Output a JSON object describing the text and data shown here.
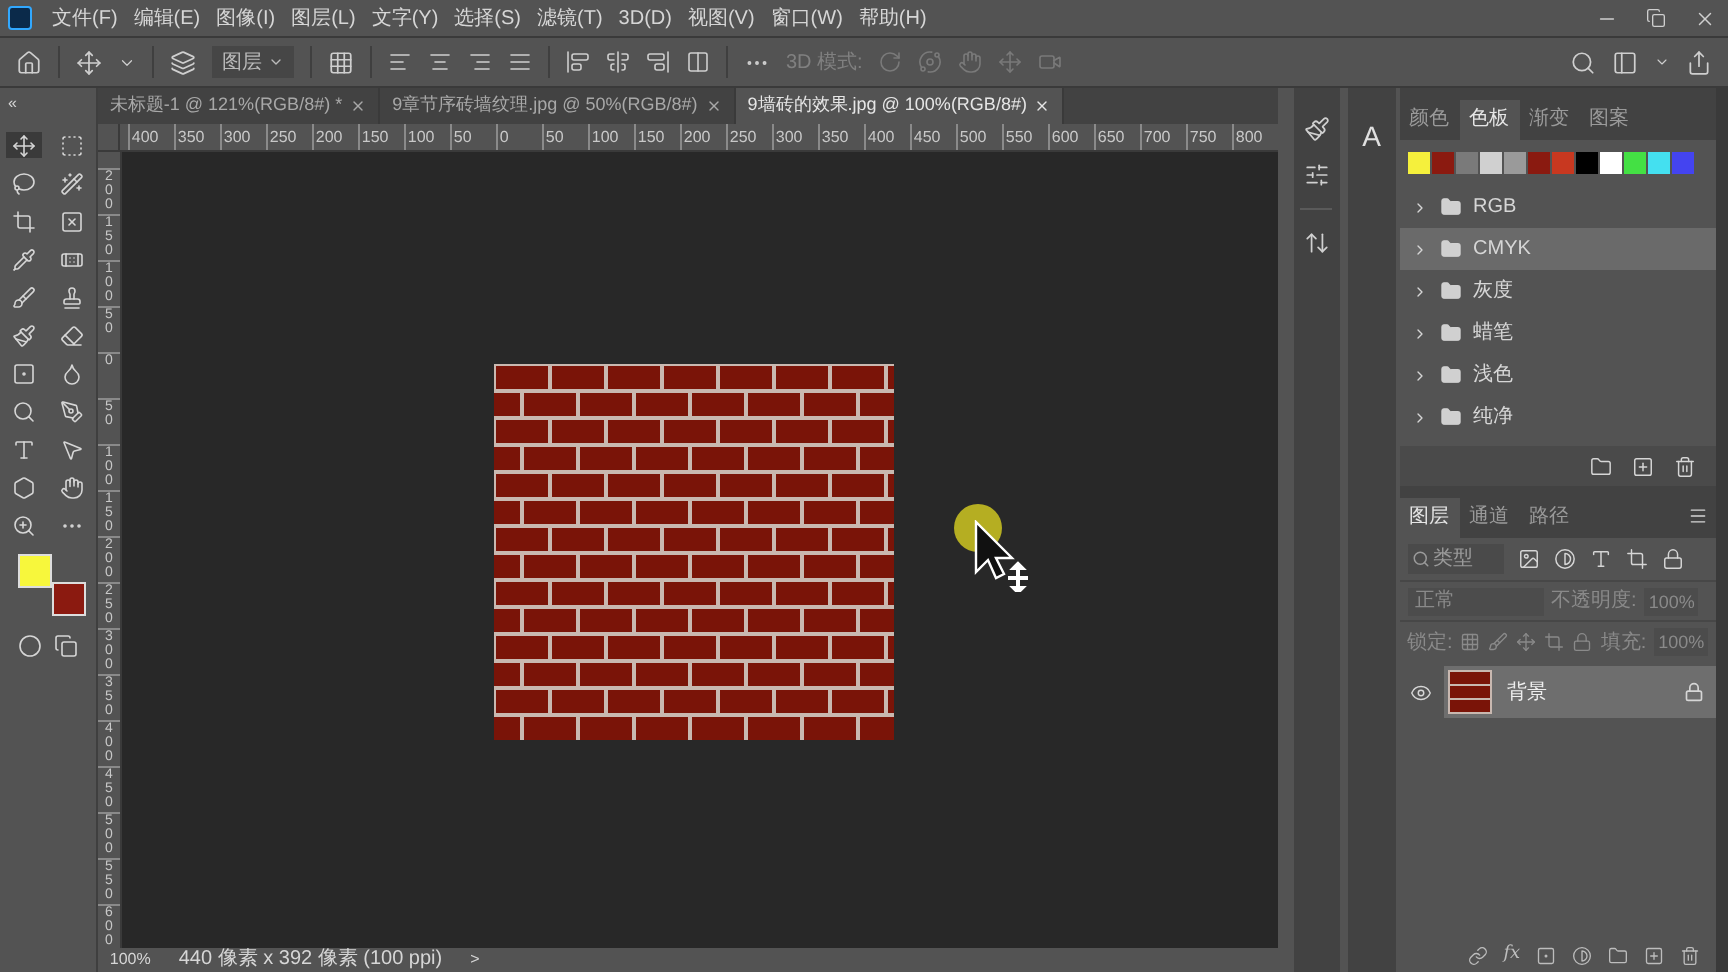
{
  "menu": [
    "文件(F)",
    "编辑(E)",
    "图像(I)",
    "图层(L)",
    "文字(Y)",
    "选择(S)",
    "滤镜(T)",
    "3D(D)",
    "视图(V)",
    "窗口(W)",
    "帮助(H)"
  ],
  "options": {
    "auto_select": "图层",
    "mode_3d": "3D 模式:"
  },
  "doc_tabs": [
    {
      "label": "未标题-1 @ 121%(RGB/8#) *",
      "selected": false
    },
    {
      "label": "9章节序砖墙纹理.jpg @ 50%(RGB/8#)",
      "selected": false
    },
    {
      "label": "9墙砖的效果.jpg @ 100%(RGB/8#)",
      "selected": true
    }
  ],
  "ruler_h": [
    "400",
    "350",
    "300",
    "250",
    "200",
    "150",
    "100",
    "50",
    "0",
    "50",
    "100",
    "150",
    "200",
    "250",
    "300",
    "350",
    "400",
    "450",
    "500",
    "550",
    "600",
    "650",
    "700",
    "750",
    "800"
  ],
  "ruler_v": [
    "200",
    "150",
    "100",
    "50",
    "0",
    "50",
    "100",
    "150",
    "200",
    "250",
    "300",
    "350",
    "400",
    "450",
    "500",
    "550",
    "600"
  ],
  "collapse": "«",
  "status": {
    "zoom": "100%",
    "size": "440 像素 x 392 像素 (100 ppi)",
    "arrow": ">"
  },
  "side_icons": {
    "char_panel": "A"
  },
  "color_panel": {
    "tabs": [
      {
        "label": "颜色",
        "selected": false
      },
      {
        "label": "色板",
        "selected": true
      },
      {
        "label": "渐变",
        "selected": false
      },
      {
        "label": "图案",
        "selected": false
      }
    ],
    "swatches": [
      {
        "color": "#f5f03c"
      },
      {
        "color": "#8b1a10"
      },
      {
        "color": "#7a7a7a"
      },
      {
        "color": "#d0d0d0"
      },
      {
        "color": "#9a9a9a"
      },
      {
        "color": "#8a1a10"
      },
      {
        "color": "#c83820"
      },
      {
        "color": "#000000"
      },
      {
        "color": "#ffffff"
      },
      {
        "color": "#44e044"
      },
      {
        "color": "#44e0f0"
      },
      {
        "color": "#4444f0"
      }
    ],
    "groups": [
      {
        "label": "RGB",
        "selected": false
      },
      {
        "label": "CMYK",
        "selected": true
      },
      {
        "label": "灰度",
        "selected": false
      },
      {
        "label": "蜡笔",
        "selected": false
      },
      {
        "label": "浅色",
        "selected": false
      },
      {
        "label": "纯净",
        "selected": false
      }
    ]
  },
  "layers_panel": {
    "tabs": [
      {
        "label": "图层",
        "selected": true
      },
      {
        "label": "通道",
        "selected": false
      },
      {
        "label": "路径",
        "selected": false
      }
    ],
    "fx_label": "fx",
    "filter_placeholder": "类型",
    "blend": "正常",
    "opacity_label": "不透明度:",
    "opacity": "100%",
    "lock_label": "锁定:",
    "fill_label": "填充:",
    "fill": "100%",
    "layers": [
      {
        "name": "背景",
        "visible": true,
        "selected": true
      }
    ]
  }
}
